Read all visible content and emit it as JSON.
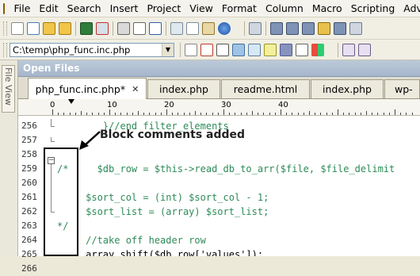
{
  "menubar": {
    "items": [
      "File",
      "Edit",
      "Search",
      "Insert",
      "Project",
      "View",
      "Format",
      "Column",
      "Macro",
      "Scripting",
      "Advan"
    ]
  },
  "toolbar": {
    "path_value": "C:\\temp\\php_func.inc.php",
    "path_dropdown_glyph": "▼"
  },
  "sidebar": {
    "file_view_label": "File View"
  },
  "open_files": {
    "title": "Open Files"
  },
  "tabs": [
    {
      "label": "php_func.inc.php*",
      "close": "✕"
    },
    {
      "label": "index.php"
    },
    {
      "label": "readme.html"
    },
    {
      "label": "index.php"
    },
    {
      "label": "wp-"
    }
  ],
  "ruler": {
    "labels": [
      "0",
      "10",
      "20",
      "30",
      "40"
    ]
  },
  "editor": {
    "lines": [
      {
        "num": "256",
        "text": "        }//end filter_elements",
        "color": "#2e8b57"
      },
      {
        "num": "257",
        "text": "",
        "color": "#000000"
      },
      {
        "num": "258",
        "text": "",
        "color": "#000000"
      },
      {
        "num": "259",
        "text": "/*     $db_row = $this->read_db_to_arr($file, $file_delimit",
        "color": "#2e8b57"
      },
      {
        "num": "260",
        "text": "",
        "color": "#000000"
      },
      {
        "num": "261",
        "text": "     $sort_col = (int) $sort_col - 1;",
        "color": "#2e8b57"
      },
      {
        "num": "262",
        "text": "     $sort_list = (array) $sort_list;",
        "color": "#2e8b57"
      },
      {
        "num": "263",
        "text": "*/",
        "color": "#2e8b57"
      },
      {
        "num": "264",
        "text": "     //take off header row",
        "color": "#2e8b57"
      },
      {
        "num": "265",
        "text": "     array_shift($db_row['values']);",
        "color": "#000000"
      },
      {
        "num": "266",
        "text": "",
        "color": "#000000"
      }
    ]
  },
  "annotation": {
    "text": "Block comments added"
  },
  "colors": {
    "comment": "#2e8b57",
    "highlight": "#cfe4f2",
    "accent": "#a6b6cb"
  },
  "icons": [
    "new-file-icon",
    "open-folder-icon",
    "save-icon",
    "close-file-icon",
    "print-icon",
    "find-icon",
    "replace-icon",
    "google-icon",
    "wikipedia-icon",
    "php-icon",
    "dropdown-icon"
  ]
}
